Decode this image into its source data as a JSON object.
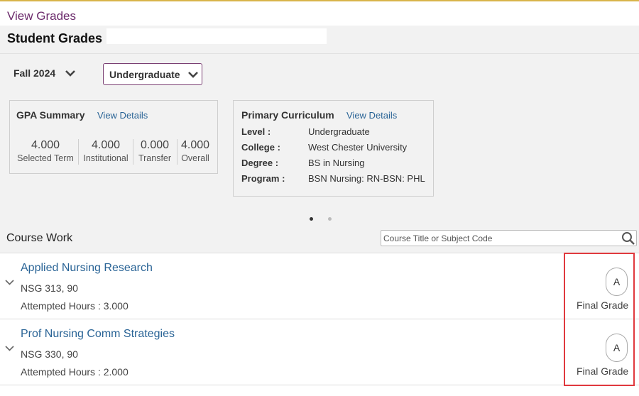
{
  "header": {
    "title": "View Grades"
  },
  "student_grades": {
    "title": "Student Grades"
  },
  "filters": {
    "term": "Fall 2024",
    "career": "Undergraduate"
  },
  "gpa_summary": {
    "title": "GPA Summary",
    "view_details": "View Details",
    "items": [
      {
        "value": "4.000",
        "label": "Selected Term"
      },
      {
        "value": "4.000",
        "label": "Institutional"
      },
      {
        "value": "0.000",
        "label": "Transfer"
      },
      {
        "value": "4.000",
        "label": "Overall"
      }
    ]
  },
  "curriculum": {
    "title": "Primary Curriculum",
    "view_details": "View Details",
    "rows": [
      {
        "key": "Level :",
        "value": "Undergraduate"
      },
      {
        "key": "College :",
        "value": "West Chester University"
      },
      {
        "key": "Degree :",
        "value": "BS in Nursing"
      },
      {
        "key": "Program :",
        "value": "BSN Nursing: RN-BSN: PHL"
      }
    ]
  },
  "pager": {
    "active_color": "#333333",
    "inactive_color": "#bbbbbb"
  },
  "course_work": {
    "title": "Course Work",
    "search_placeholder": "Course Title or Subject Code",
    "courses": [
      {
        "title": "Applied Nursing Research",
        "code": "NSG 313, 90",
        "hours": "Attempted Hours : 3.000",
        "grade": "A",
        "grade_label": "Final Grade"
      },
      {
        "title": "Prof Nursing Comm Strategies",
        "code": "NSG 330, 90",
        "hours": "Attempted Hours : 2.000",
        "grade": "A",
        "grade_label": "Final Grade"
      }
    ]
  },
  "colors": {
    "brand": "#6b2a6b",
    "link": "#2a6496",
    "highlight": "#e0393e",
    "accent_line": "#d9b44a"
  }
}
